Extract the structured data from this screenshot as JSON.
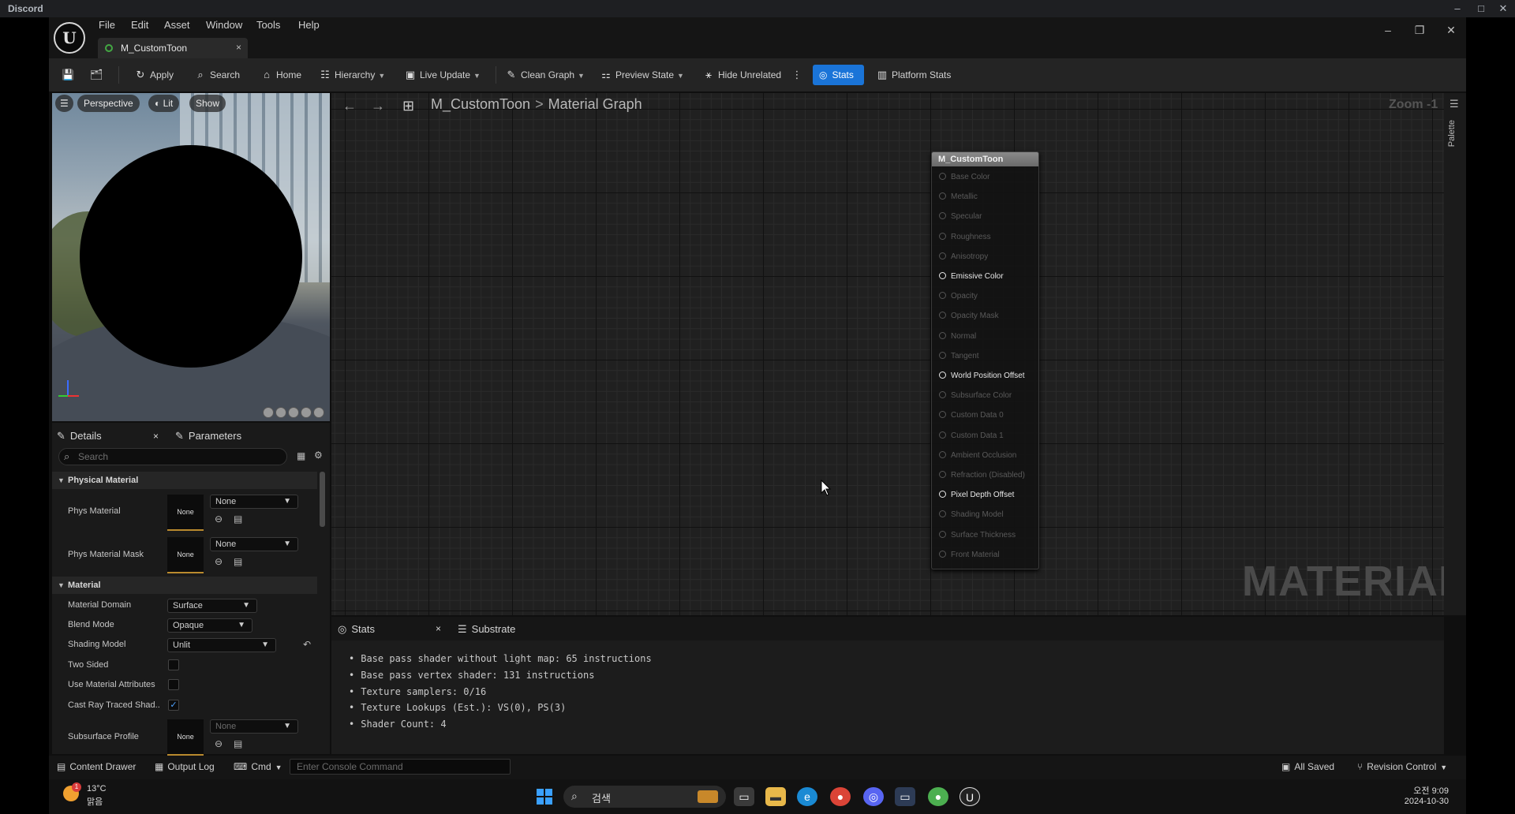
{
  "outer_window": {
    "title": "Discord",
    "controls": [
      "–",
      "□",
      "✕"
    ]
  },
  "app": {
    "menus": [
      "File",
      "Edit",
      "Asset",
      "Window",
      "Tools",
      "Help"
    ],
    "tab": {
      "label": "M_CustomToon",
      "close": "×"
    },
    "window_controls": [
      "–",
      "❐",
      "✕"
    ]
  },
  "toolbar": {
    "apply": "Apply",
    "search": "Search",
    "home": "Home",
    "hierarchy": "Hierarchy",
    "live_update": "Live Update",
    "clean_graph": "Clean Graph",
    "preview_state": "Preview State",
    "hide_unrelated": "Hide Unrelated",
    "stats": "Stats",
    "platform_stats": "Platform Stats"
  },
  "viewport": {
    "perspective": "Perspective",
    "lit": "Lit",
    "show": "Show"
  },
  "details": {
    "tab_details": "Details",
    "tab_close": "×",
    "tab_parameters": "Parameters",
    "search_placeholder": "Search",
    "section_physical": "Physical Material",
    "phys_material": {
      "label": "Phys Material",
      "thumb": "None",
      "value": "None"
    },
    "phys_material_mask": {
      "label": "Phys Material Mask",
      "thumb": "None",
      "value": "None"
    },
    "section_material": "Material",
    "material_domain": {
      "label": "Material Domain",
      "value": "Surface"
    },
    "blend_mode": {
      "label": "Blend Mode",
      "value": "Opaque"
    },
    "shading_model": {
      "label": "Shading Model",
      "value": "Unlit"
    },
    "two_sided": {
      "label": "Two Sided",
      "checked": false
    },
    "use_material_attributes": {
      "label": "Use Material Attributes",
      "checked": false
    },
    "cast_ray_traced": {
      "label": "Cast Ray Traced Shad..",
      "checked": true,
      "mark": "✓"
    },
    "subsurface_profile": {
      "label": "Subsurface Profile",
      "thumb": "None",
      "value": "None"
    }
  },
  "graph": {
    "breadcrumb_root": "M_CustomToon",
    "breadcrumb_sep": ">",
    "breadcrumb_page": "Material Graph",
    "zoom": "Zoom -1",
    "watermark": "MATERIAL",
    "palette_label": "Palette",
    "node": {
      "title": "M_CustomToon",
      "pins": [
        {
          "label": "Base Color",
          "active": false
        },
        {
          "label": "Metallic",
          "active": false
        },
        {
          "label": "Specular",
          "active": false
        },
        {
          "label": "Roughness",
          "active": false
        },
        {
          "label": "Anisotropy",
          "active": false
        },
        {
          "label": "Emissive Color",
          "active": true
        },
        {
          "label": "Opacity",
          "active": false
        },
        {
          "label": "Opacity Mask",
          "active": false
        },
        {
          "label": "Normal",
          "active": false
        },
        {
          "label": "Tangent",
          "active": false
        },
        {
          "label": "World Position Offset",
          "active": true
        },
        {
          "label": "Subsurface Color",
          "active": false
        },
        {
          "label": "Custom Data 0",
          "active": false
        },
        {
          "label": "Custom Data 1",
          "active": false
        },
        {
          "label": "Ambient Occlusion",
          "active": false
        },
        {
          "label": "Refraction (Disabled)",
          "active": false
        },
        {
          "label": "Pixel Depth Offset",
          "active": true
        },
        {
          "label": "Shading Model",
          "active": false
        },
        {
          "label": "Surface Thickness",
          "active": false
        },
        {
          "label": "Front Material",
          "active": false
        }
      ]
    }
  },
  "stats_panel": {
    "tab_stats": "Stats",
    "tab_close": "×",
    "tab_substrate": "Substrate",
    "lines": [
      "Base pass shader without light map: 65 instructions",
      "Base pass vertex shader: 131 instructions",
      "Texture samplers: 0/16",
      "Texture Lookups (Est.): VS(0), PS(3)",
      "Shader Count: 4"
    ]
  },
  "status_bar": {
    "content_drawer": "Content Drawer",
    "output_log": "Output Log",
    "cmd": "Cmd",
    "console_placeholder": "Enter Console Command",
    "all_saved": "All Saved",
    "revision_control": "Revision Control"
  },
  "taskbar": {
    "temperature": "13°C",
    "condition": "맑음",
    "weather_badge": "1",
    "search_text": "검색",
    "time": "오전 9:09",
    "date": "2024-10-30"
  },
  "colors": {
    "accent": "#1a74d8",
    "tab_dot": "#43a843",
    "thumb_border": "#b98a2e"
  }
}
